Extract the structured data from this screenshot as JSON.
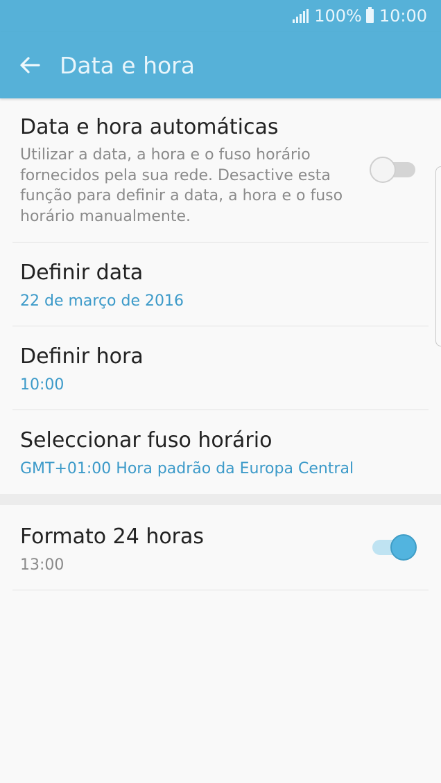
{
  "status_bar": {
    "battery": "100%",
    "time": "10:00"
  },
  "header": {
    "title": "Data e hora"
  },
  "settings": {
    "auto": {
      "title": "Data e hora automáticas",
      "description": [
        "Utilizar a data, a hora e o fuso horário",
        "fornecidos pela sua rede. Desactive esta",
        "função para definir a data, a hora e o fuso",
        "horário manualmente."
      ],
      "enabled": false
    },
    "set_date": {
      "title": "Definir data",
      "value": "22 de março de 2016"
    },
    "set_time": {
      "title": "Definir hora",
      "value": "10:00"
    },
    "timezone": {
      "title": "Seleccionar fuso horário",
      "value": "GMT+01:00 Hora padrão da Europa Central"
    },
    "format24": {
      "title": "Formato 24 horas",
      "value": "13:00",
      "enabled": true
    }
  },
  "colors": {
    "accent": "#56b1d8",
    "value_text": "#3c9ac9"
  }
}
